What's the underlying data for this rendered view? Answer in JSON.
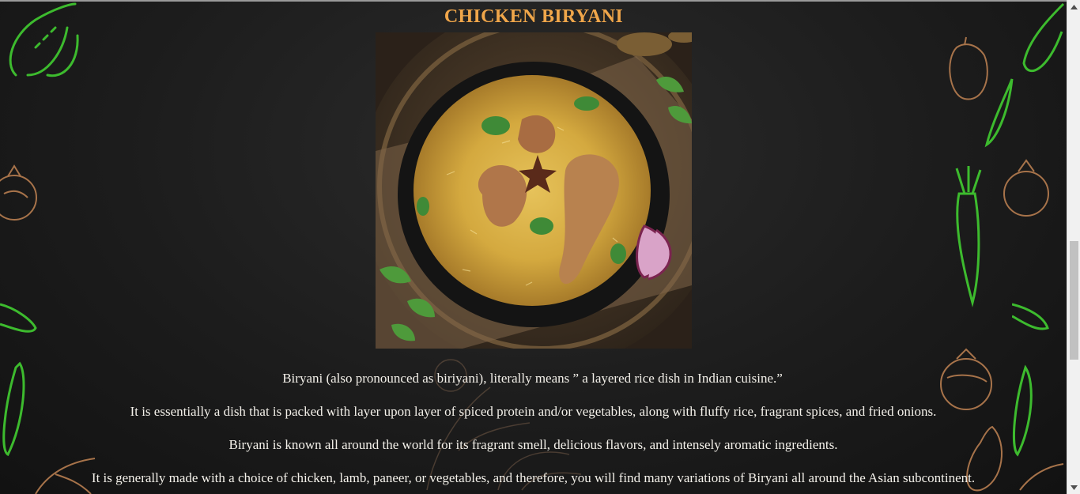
{
  "page": {
    "title": "CHICKEN BIRYANI",
    "image_alt": "Chicken biryani in a black bowl",
    "paragraphs": [
      "Biryani (also pronounced as biriyani), literally means ” a layered rice dish in Indian cuisine.”",
      "It is essentially a dish that is packed with layer upon layer of spiced protein and/or vegetables, along with fluffy rice, fragrant spices, and fried onions.",
      "Biryani is known all around the world for its fragrant smell, delicious flavors, and intensely aromatic ingredients.",
      "It is generally made with a choice of chicken, lamb, paneer, or vegetables, and therefore, you will find many variations of Biryani all around the Asian subcontinent."
    ]
  },
  "colors": {
    "title": "#f0a64a",
    "text": "#f4f1ea",
    "background": "#1c1c1c",
    "doodle_green": "#3dbb2e",
    "doodle_brown": "#a7734a"
  },
  "icons": {
    "scroll_up": "triangle-up-icon",
    "scroll_down": "triangle-down-icon"
  }
}
